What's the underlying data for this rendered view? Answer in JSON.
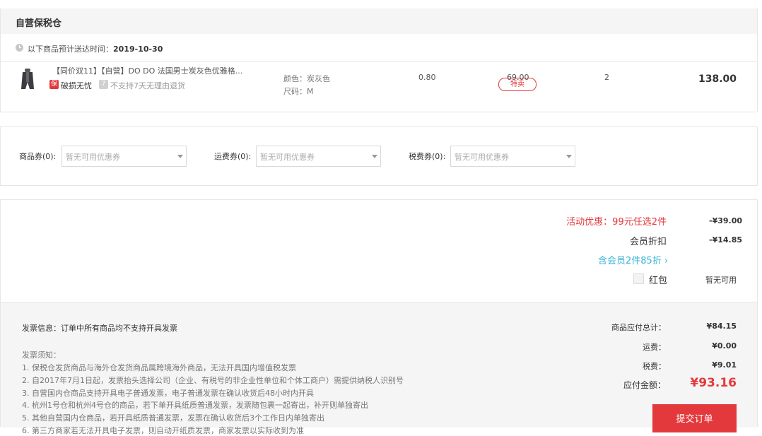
{
  "warehouse": {
    "title": "自营保税仓"
  },
  "delivery": {
    "label": "以下商品预计送达时间：",
    "date": "2019-10-30"
  },
  "product": {
    "name": "【同价双11】【自营】DO DO 法国男士炭灰色优雅格...",
    "tag_bao": "保",
    "tag_bao_text": "破损无忧",
    "tag_7": "7",
    "tag_7_text": "不支持7天无理由退货",
    "color": "颜色：炭灰色",
    "size": "尺码：M",
    "tax_rate": "0.80",
    "price": "69.00",
    "sale_badge": "特卖",
    "quantity": "2",
    "subtotal": "138.00"
  },
  "coupons": [
    {
      "label": "商品券(0):",
      "placeholder": "暂无可用优惠券"
    },
    {
      "label": "运费券(0):",
      "placeholder": "暂无可用优惠券"
    },
    {
      "label": "税费券(0):",
      "placeholder": "暂无可用优惠券"
    }
  ],
  "discounts": {
    "promo_label": "活动优惠：99元任选2件",
    "promo_amount": "-¥39.00",
    "member_label": "会员折扣",
    "member_amount": "-¥14.85",
    "member_link": "含会员2件85折",
    "redpacket_label": "红包",
    "redpacket_value": "暂无可用"
  },
  "invoice": {
    "info": "发票信息：订单中所有商品均不支持开具发票",
    "notice_title": "发票须知：",
    "notices": [
      "1. 保税仓发货商品与海外仓发货商品属跨境海外商品，无法开具国内增值税发票",
      "2. 自2017年7月1日起，发票抬头选择公司（企业、有税号的非企业性单位和个体工商户）需提供纳税人识别号",
      "3. 自营国内仓商品支持开具电子普通发票，电子普通发票在确认收货后48小时内开具",
      "4. 杭州1号仓和杭州4号仓的商品，若下单开具纸质普通发票，发票随包裹一起寄出，补开则单独寄出",
      "5. 其他自营国内仓商品，若开具纸质普通发票，发票在确认收货后3个工作日内单独寄出",
      "6. 第三方商家若无法开具电子发票，则自动开纸质发票，商家发票以实际收到为准"
    ]
  },
  "summary": {
    "goods_label": "商品应付总计：",
    "goods_value": "¥84.15",
    "shipping_label": "运费：",
    "shipping_value": "¥0.00",
    "tax_label": "税费：",
    "tax_value": "¥9.01",
    "total_label": "应付金额：",
    "total_value": "¥93.16"
  },
  "submit_label": "提交订单",
  "colors": {
    "accent": "#e4393c",
    "link": "#39b3d7",
    "panel": "#f5f5f5"
  }
}
